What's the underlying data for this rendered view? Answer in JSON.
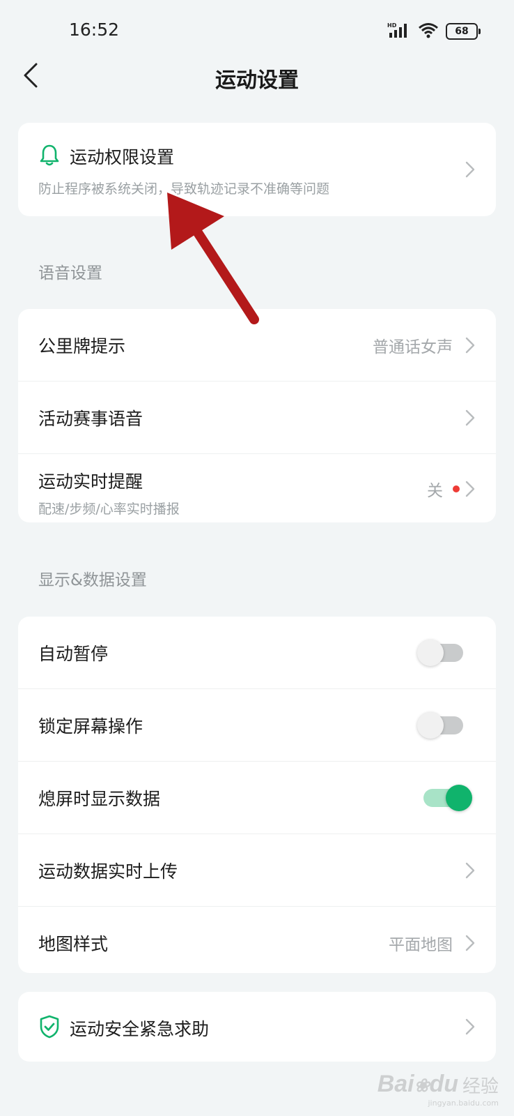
{
  "status_bar": {
    "time": "16:52",
    "battery": "68",
    "signal_icon": "signal-hd-icon",
    "wifi_icon": "wifi-icon"
  },
  "header": {
    "title": "运动设置",
    "back_icon": "back-chevron-icon"
  },
  "permission_card": {
    "title": "运动权限设置",
    "subtitle": "防止程序被系统关闭，导致轨迹记录不准确等问题",
    "icon": "bell-icon",
    "accent": "#10b36c"
  },
  "voice_section": {
    "label": "语音设置",
    "rows": [
      {
        "label": "公里牌提示",
        "value": "普通话女声"
      },
      {
        "label": "活动赛事语音",
        "value": ""
      },
      {
        "label": "运动实时提醒",
        "sub": "配速/步频/心率实时播报",
        "value": "关"
      }
    ]
  },
  "display_section": {
    "label": "显示&数据设置",
    "rows": [
      {
        "label": "自动暂停",
        "toggle": "off"
      },
      {
        "label": "锁定屏幕操作",
        "toggle": "off"
      },
      {
        "label": "熄屏时显示数据",
        "toggle": "on"
      },
      {
        "label": "运动数据实时上传",
        "value": ""
      },
      {
        "label": "地图样式",
        "value": "平面地图"
      }
    ]
  },
  "safety_card": {
    "title": "运动安全紧急求助",
    "icon": "shield-check-icon"
  },
  "watermark": {
    "logo": "Bai",
    "logo_tail": "du",
    "text": "经验",
    "url": "jingyan.baidu.com"
  },
  "colors": {
    "background": "#f2f5f6",
    "card": "#ffffff",
    "toggle_on": "#10b36c",
    "red_dot": "#ee3b36",
    "annotation_arrow": "#b3191a"
  }
}
